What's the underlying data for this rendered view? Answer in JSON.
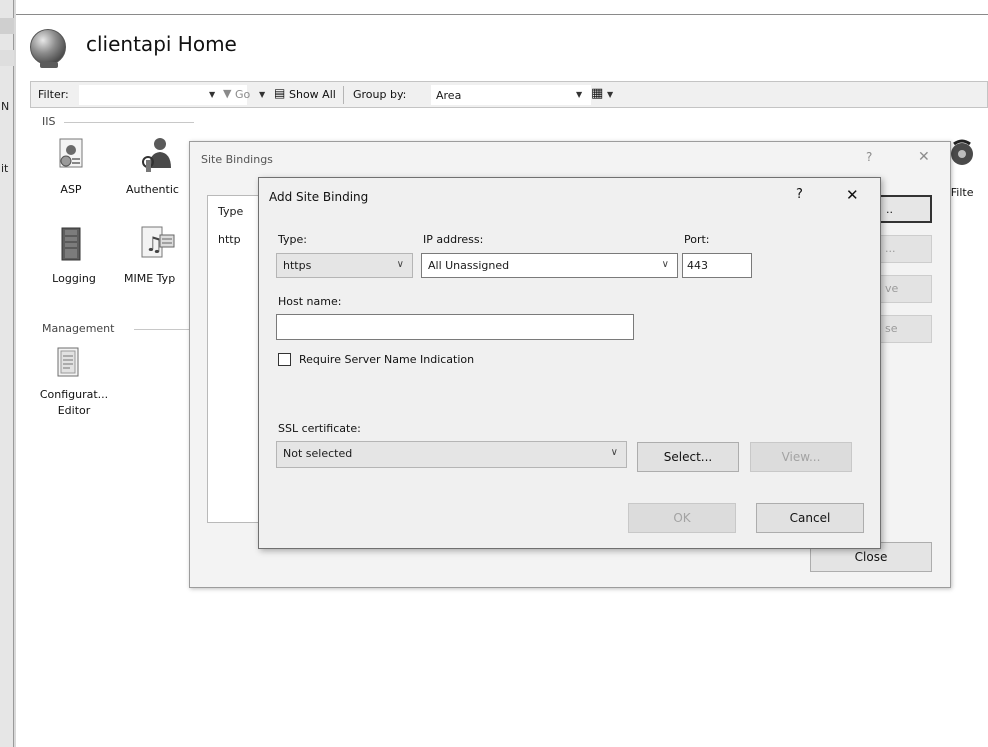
{
  "left_pane": {
    "labels": [
      "N",
      "it"
    ]
  },
  "header": {
    "title": "clientapi Home"
  },
  "filterbar": {
    "filter_label": "Filter:",
    "go_label": "Go",
    "show_all_label": "Show All",
    "group_by_label": "Group by:",
    "group_by_value": "Area"
  },
  "iis": {
    "section_label": "IIS",
    "features": [
      {
        "label": "ASP",
        "icon": "asp-icon"
      },
      {
        "label": "Authentic",
        "icon": "authentication-icon"
      },
      {
        "label": "Logging",
        "icon": "logging-icon"
      },
      {
        "label": "MIME Typ",
        "icon": "mime-types-icon"
      }
    ],
    "right_feature_label": "I Filte"
  },
  "management": {
    "section_label": "Management",
    "features": [
      {
        "label_line1": "Configurat...",
        "label_line2": "Editor",
        "icon": "configuration-editor-icon"
      }
    ]
  },
  "site_bindings": {
    "title": "Site Bindings",
    "help_label": "?",
    "close_x": "✕",
    "column_type": "Type",
    "row_type": "http",
    "side_buttons": [
      "..",
      " ...",
      "ve",
      "se"
    ],
    "close_button": "Close"
  },
  "add_binding": {
    "title": "Add Site Binding",
    "help_label": "?",
    "close_x": "✕",
    "type_label": "Type:",
    "type_value": "https",
    "ip_label": "IP address:",
    "ip_value": "All Unassigned",
    "port_label": "Port:",
    "port_value": "443",
    "host_label": "Host name:",
    "host_value": "",
    "sni_label": "Require Server Name Indication",
    "ssl_label": "SSL certificate:",
    "ssl_value": "Not selected",
    "select_button": "Select...",
    "view_button": "View...",
    "ok_button": "OK",
    "cancel_button": "Cancel"
  }
}
